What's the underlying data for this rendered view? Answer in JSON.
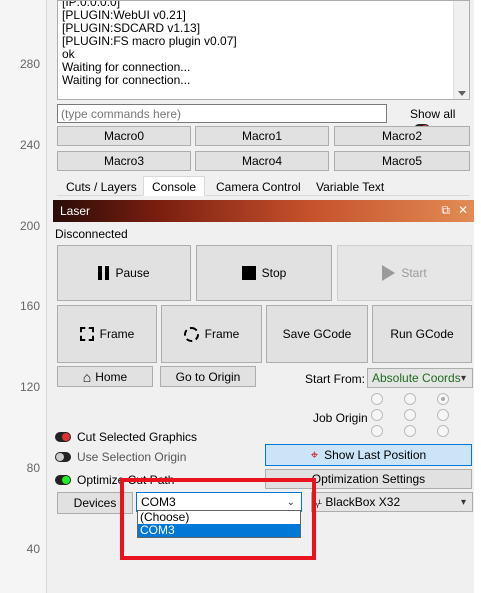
{
  "ruler": {
    "ticks": [
      "280",
      "240",
      "200",
      "160",
      "120",
      "80",
      "40"
    ]
  },
  "console": {
    "lines": [
      "[IP:0.0.0.0]",
      "[PLUGIN:WebUI v0.21]",
      "[PLUGIN:SDCARD v1.13]",
      "[PLUGIN:FS macro plugin v0.07]",
      "ok",
      "Waiting for connection...",
      "Waiting for connection..."
    ],
    "placeholder": "(type commands here)",
    "show_all": "Show all"
  },
  "macros": [
    "Macro0",
    "Macro1",
    "Macro2",
    "Macro3",
    "Macro4",
    "Macro5"
  ],
  "tabs": [
    "Cuts / Layers",
    "Console",
    "Camera Control",
    "Variable Text"
  ],
  "laser": {
    "title": "Laser",
    "status": "Disconnected",
    "pause": "Pause",
    "stop": "Stop",
    "start": "Start",
    "frame1": "Frame",
    "frame2": "Frame",
    "save_gcode": "Save GCode",
    "run_gcode": "Run GCode",
    "home": "Home",
    "go_to_origin": "Go to Origin",
    "start_from_label": "Start From:",
    "start_from_value": "Absolute Coords",
    "job_origin": "Job Origin",
    "cut_selected": "Cut Selected Graphics",
    "use_selection_origin": "Use Selection Origin",
    "optimize_cut_path": "Optimize Cut Path",
    "show_last_position": "Show Last Position",
    "optimization_settings": "Optimization Settings",
    "devices": "Devices",
    "port_value": "COM3",
    "port_options": [
      "(Choose)",
      "COM3"
    ],
    "device_value": "BlackBox X32"
  },
  "colors": {
    "accent": "#0078d7",
    "highlight": "#e8131e",
    "header_dark": "#2a0c07",
    "header_light": "#e28b54"
  }
}
